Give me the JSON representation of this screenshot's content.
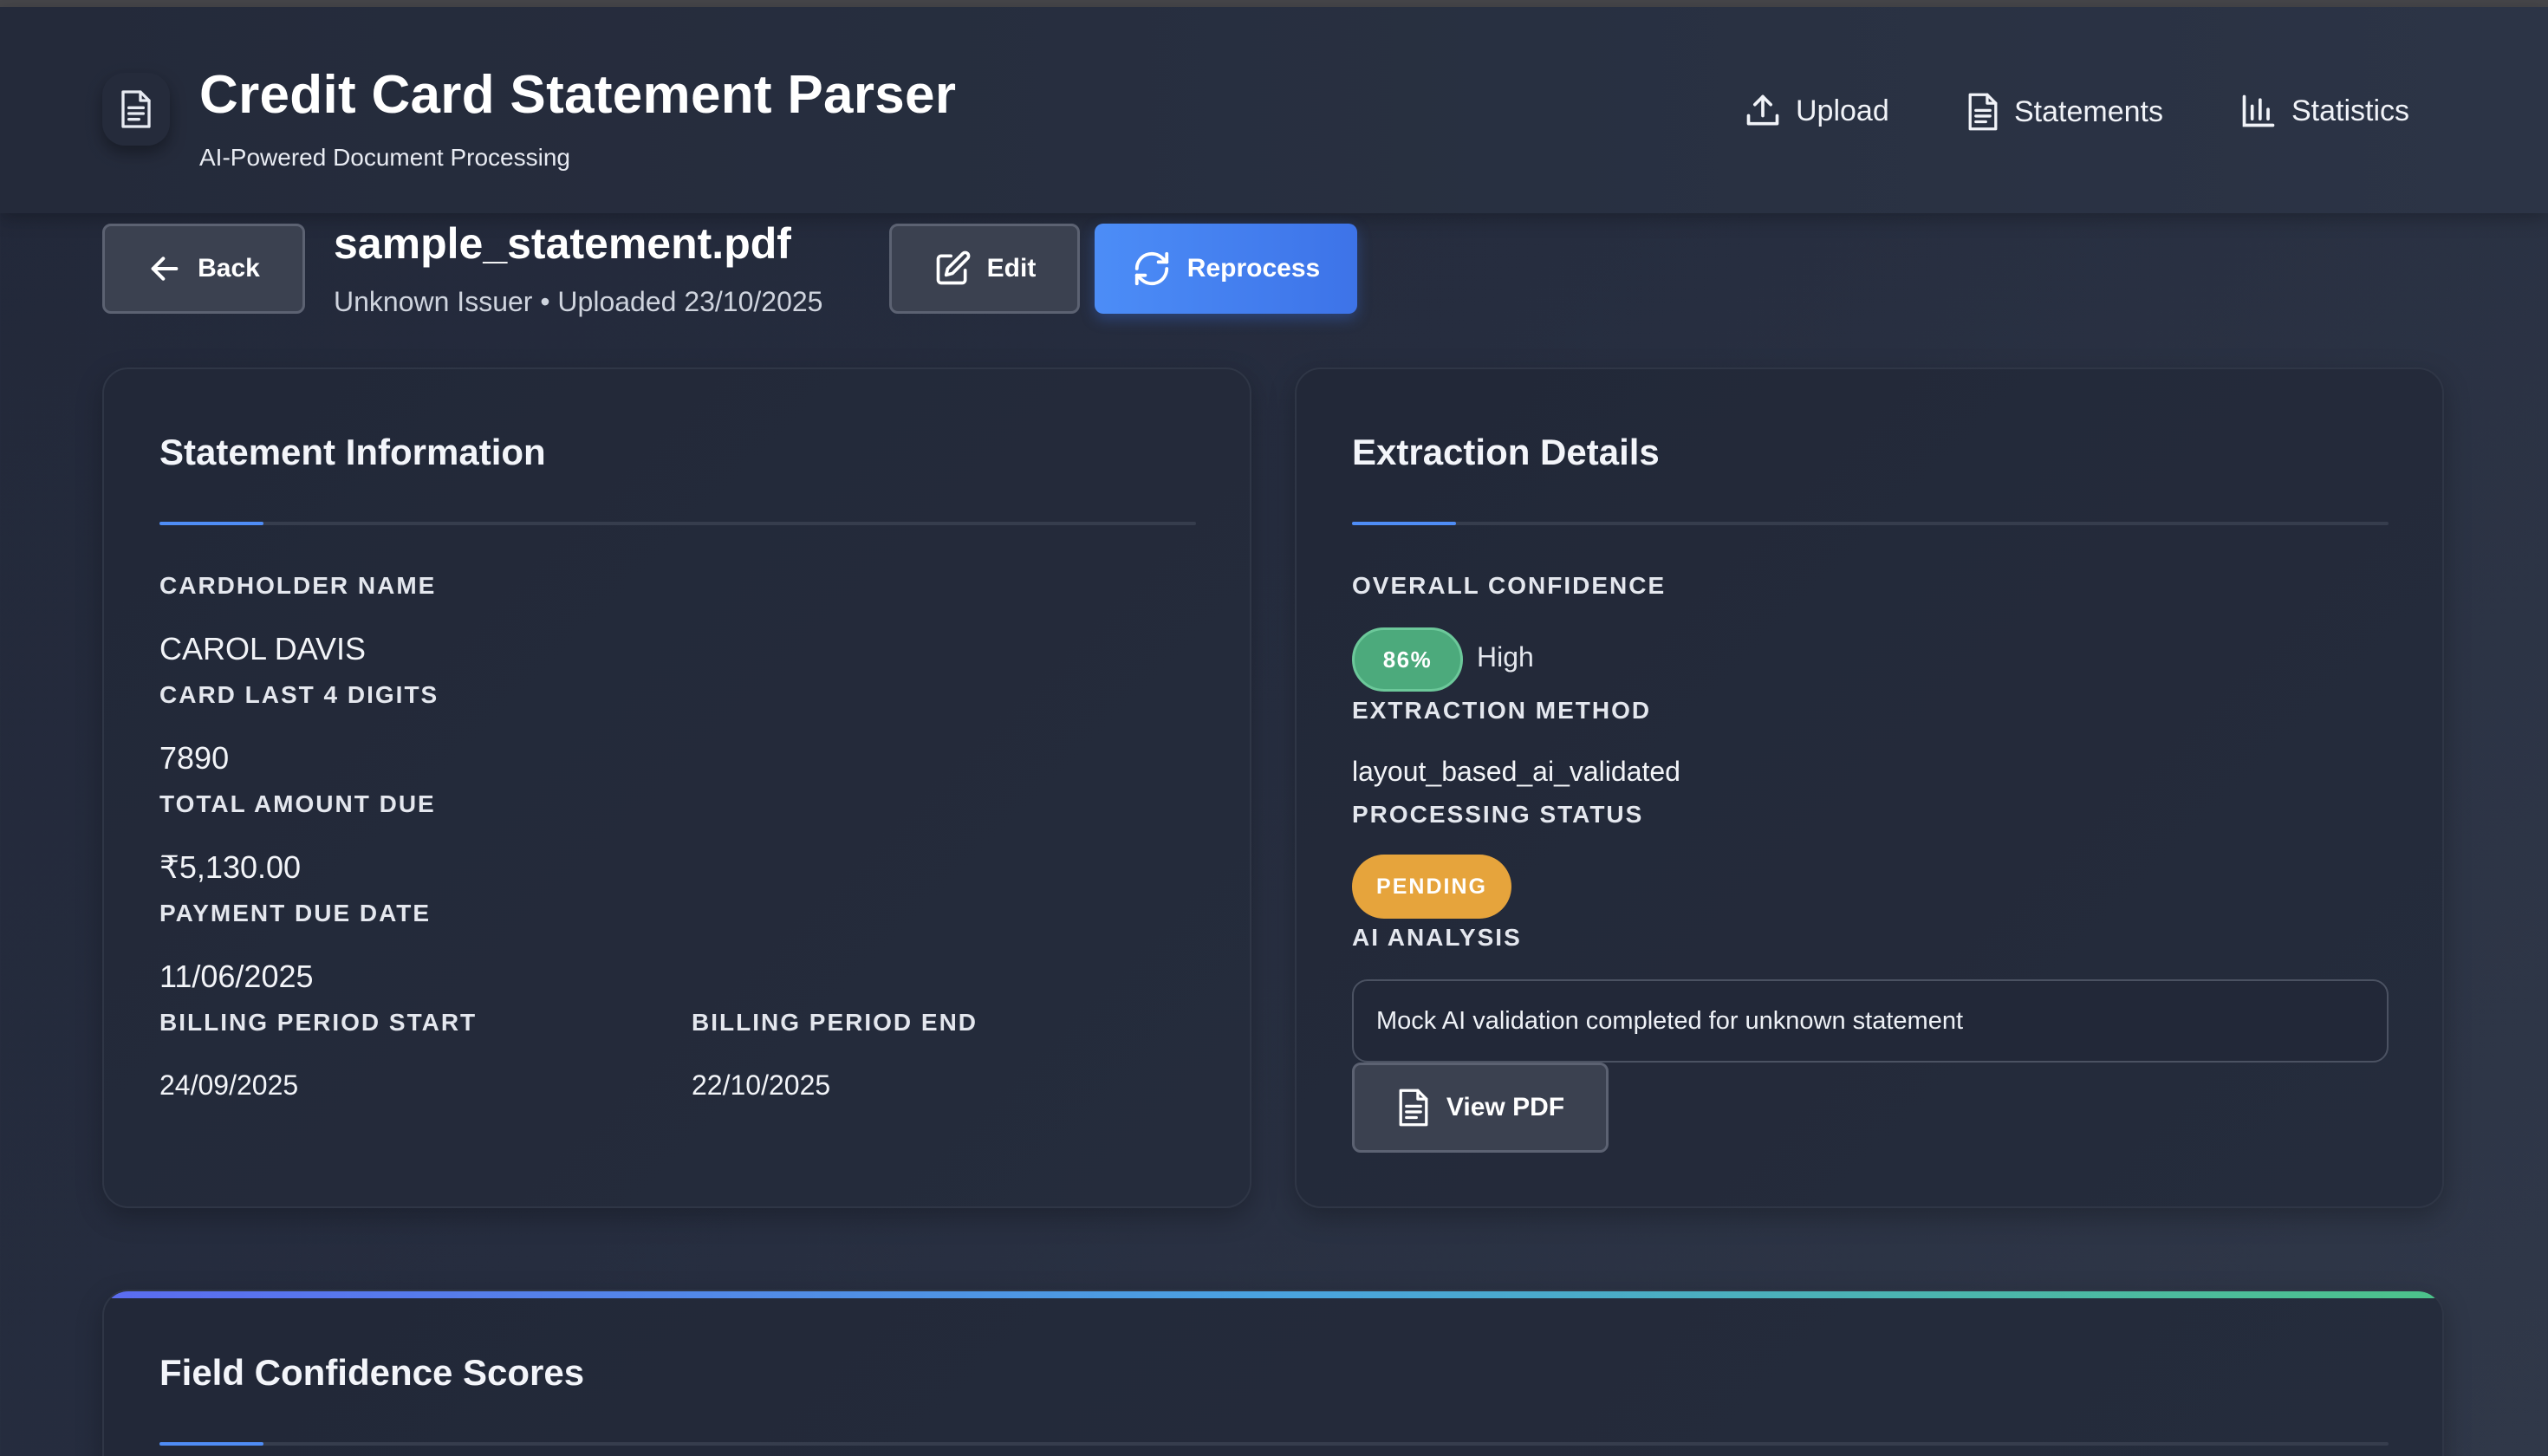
{
  "header": {
    "title": "Credit Card Statement Parser",
    "subtitle": "AI-Powered Document Processing",
    "nav": {
      "upload": "Upload",
      "statements": "Statements",
      "statistics": "Statistics"
    }
  },
  "toolbar": {
    "back_label": "Back",
    "file_name": "sample_statement.pdf",
    "file_meta": "Unknown Issuer • Uploaded 23/10/2025",
    "edit_label": "Edit",
    "reprocess_label": "Reprocess"
  },
  "statement_info": {
    "title": "Statement Information",
    "fields": {
      "cardholder_label": "CARDHOLDER NAME",
      "cardholder_value": "CAROL DAVIS",
      "last4_label": "CARD LAST 4 DIGITS",
      "last4_value": "7890",
      "total_label": "TOTAL AMOUNT DUE",
      "total_value": "₹5,130.00",
      "due_label": "PAYMENT DUE DATE",
      "due_value": "11/06/2025",
      "billing_start_label": "BILLING PERIOD START",
      "billing_start_value": "24/09/2025",
      "billing_end_label": "BILLING PERIOD END",
      "billing_end_value": "22/10/2025"
    }
  },
  "extraction": {
    "title": "Extraction Details",
    "confidence_label": "OVERALL CONFIDENCE",
    "confidence_value": "86%",
    "confidence_level": "High",
    "method_label": "EXTRACTION METHOD",
    "method_value": "layout_based_ai_validated",
    "status_label": "PROCESSING STATUS",
    "status_value": "PENDING",
    "ai_label": "AI ANALYSIS",
    "ai_text": "Mock AI validation completed for unknown statement",
    "view_pdf_label": "View PDF"
  },
  "field_confidence": {
    "title": "Field Confidence Scores"
  },
  "colors": {
    "accent_blue": "#4f8df6",
    "confidence_green": "#4caa7c",
    "status_orange": "#e6a43c"
  }
}
